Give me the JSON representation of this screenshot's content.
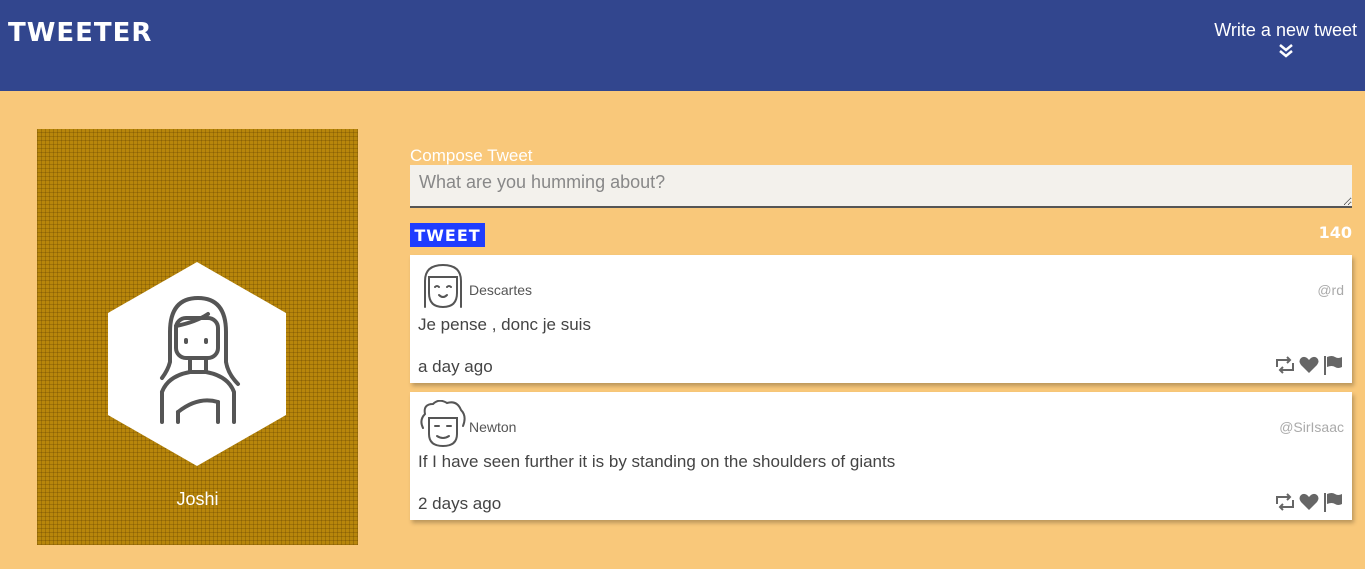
{
  "app": {
    "brand": "TWEETER"
  },
  "nav": {
    "compose_label": "Write a new tweet",
    "compose_icon": "double-chevron-down-icon"
  },
  "profile": {
    "name": "Joshi",
    "avatar_icon": "user-avatar-icon"
  },
  "compose": {
    "title": "Compose Tweet",
    "placeholder": "What are you humming about?",
    "value": "",
    "button_label": "TWEET",
    "char_count": "140"
  },
  "tweets": [
    {
      "name": "Descartes",
      "handle": "@rd",
      "text": "Je pense , donc je suis",
      "time": "a day ago"
    },
    {
      "name": "Newton",
      "handle": "@SirIsaac",
      "text": "If I have seen further it is by standing on the shoulders of giants",
      "time": "2 days ago"
    }
  ],
  "colors": {
    "navbar": "#32468e",
    "background": "#f9c87a",
    "button": "#1f3cff",
    "profile_panel": "#b8860b"
  }
}
